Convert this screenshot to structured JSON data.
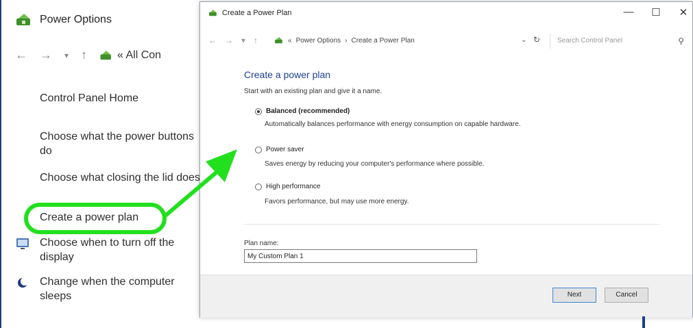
{
  "back_window": {
    "title": "Power Options",
    "breadcrumb": "« All Con",
    "links": [
      "Control Panel Home",
      "Choose what the power buttons do",
      "Choose what closing the lid does",
      "Create a power plan",
      "Choose when to turn off the display",
      "Change when the computer sleeps"
    ]
  },
  "dialog": {
    "title": "Create a Power Plan",
    "address": {
      "crumb_power_options": "Power Options",
      "crumb_current": "Create a Power Plan",
      "search_placeholder": "Search Control Panel"
    },
    "heading": "Create a power plan",
    "subheading": "Start with an existing plan and give it a name.",
    "options": [
      {
        "label": "Balanced (recommended)",
        "desc": "Automatically balances performance with energy consumption on capable hardware.",
        "selected": true
      },
      {
        "label": "Power saver",
        "desc": "Saves energy by reducing your computer's performance where possible.",
        "selected": false
      },
      {
        "label": "High performance",
        "desc": "Favors performance, but may use more energy.",
        "selected": false
      }
    ],
    "plan_name_label": "Plan name:",
    "plan_name_value": "My Custom Plan 1",
    "next_label": "Next",
    "cancel_label": "Cancel"
  },
  "colors": {
    "highlight": "#22e01e",
    "heading": "#1e3f8f"
  }
}
